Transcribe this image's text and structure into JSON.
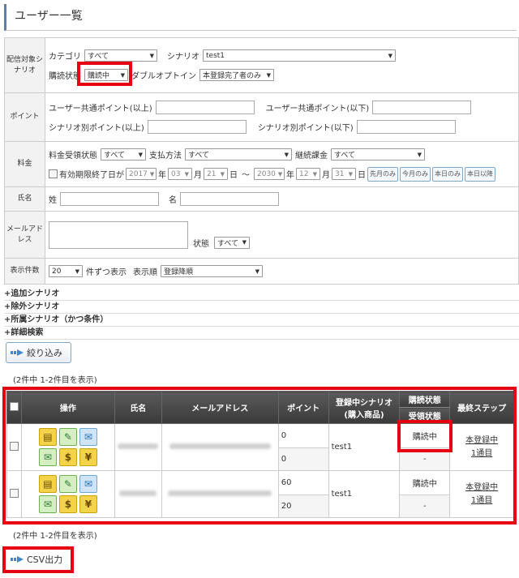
{
  "page_title": "ユーザー一覧",
  "search": {
    "delivery": {
      "label": "配信対象シナリオ",
      "category_label": "カテゴリ",
      "category_value": "すべて",
      "scenario_label": "シナリオ",
      "scenario_value": "test1",
      "subscription_label": "購読状態",
      "subscription_value": "購読中",
      "double_optin_label": "ダブルオプトイン",
      "double_optin_value": "本登録完了者のみ"
    },
    "points": {
      "label": "ポイント",
      "common_min": "ユーザー共通ポイント(以上)",
      "common_max": "ユーザー共通ポイント(以下)",
      "scenario_min": "シナリオ別ポイント(以上)",
      "scenario_max": "シナリオ別ポイント(以下)"
    },
    "fee": {
      "label": "料金",
      "receipt_label": "料金受領状態",
      "receipt_value": "すべて",
      "payment_label": "支払方法",
      "payment_value": "すべて",
      "recurring_label": "継続課金",
      "recurring_value": "すべて",
      "expiry_label": "有効期限終了日が",
      "from_year": "2017",
      "year_unit": "年",
      "from_month": "03",
      "month_unit": "月",
      "from_day": "21",
      "day_unit": "日",
      "tilde": "～",
      "to_year": "2030",
      "to_month": "12",
      "to_day": "31",
      "btn_first_month": "先月のみ",
      "btn_this_month": "今月のみ",
      "btn_today": "本日のみ",
      "btn_after_today": "本日以降"
    },
    "name": {
      "label": "氏名",
      "last_label": "姓",
      "first_label": "名"
    },
    "email": {
      "label": "メールアドレス",
      "status_label": "状態",
      "status_value": "すべて"
    },
    "display": {
      "label": "表示件数",
      "count_value": "20",
      "per_label": "件ずつ表示",
      "order_label": "表示順",
      "order_value": "登録降順"
    }
  },
  "toggles": [
    "+追加シナリオ",
    "+除外シナリオ",
    "+所属シナリオ（かつ条件）",
    "+詳細検索"
  ],
  "filter_button": "絞り込み",
  "count_text_top": "(2件中 1-2件目を表示)",
  "count_text_bottom": "(2件中 1-2件目を表示)",
  "table": {
    "headers": {
      "operation": "操作",
      "name": "氏名",
      "email": "メールアドレス",
      "point": "ポイント",
      "scenario": "登録中シナリオ",
      "scenario_sub": "(購入商品)",
      "subscription": "購読状態",
      "receipt": "受領状態",
      "last_step": "最終ステップ"
    },
    "rows": [
      {
        "point_common": "0",
        "point_scenario": "0",
        "scenario": "test1",
        "subscription": "購読中",
        "receipt": "-",
        "step_line1": "本登録中",
        "step_line2": "1通目"
      },
      {
        "point_common": "60",
        "point_scenario": "20",
        "scenario": "test1",
        "subscription": "購読中",
        "receipt": "-",
        "step_line1": "本登録中",
        "step_line2": "1通目"
      }
    ],
    "op_icons": {
      "dollar": "$",
      "yen": "¥"
    }
  },
  "csv_button": "CSV出力",
  "colors": {
    "highlight": "#e60012",
    "header_bg": "#444444",
    "accent": "#5a7fa8"
  }
}
